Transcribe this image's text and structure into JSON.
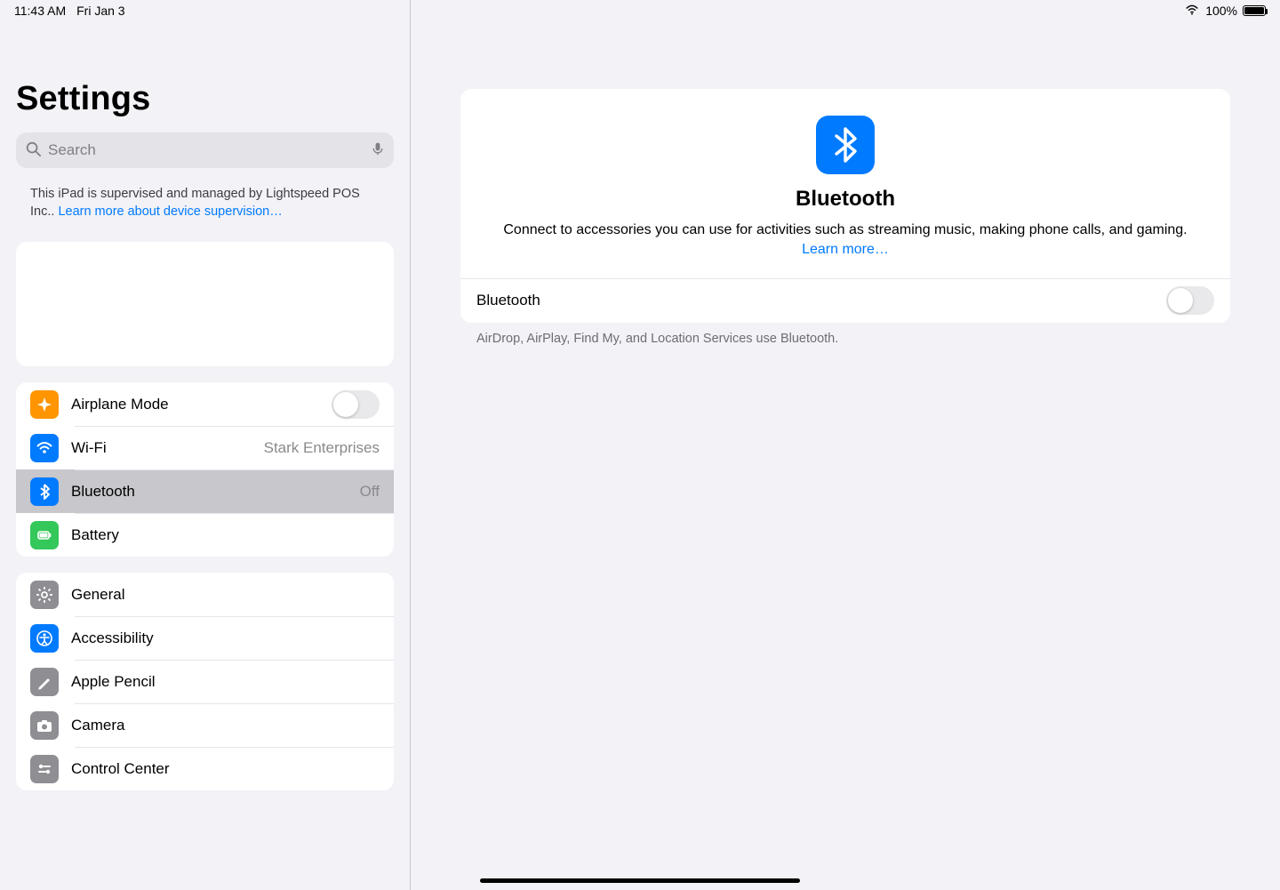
{
  "statusbar": {
    "time": "11:43 AM",
    "date": "Fri Jan 3",
    "battery_pct": "100%"
  },
  "page_title": "Settings",
  "search": {
    "placeholder": "Search"
  },
  "supervision": {
    "text": "This iPad is supervised and managed by Lightspeed POS Inc.. ",
    "link": "Learn more about device supervision…"
  },
  "sidebar": {
    "g1": [
      {
        "label": "Airplane Mode",
        "icon": "airplane",
        "iconbg": "bg-orange",
        "toggle": true
      },
      {
        "label": "Wi-Fi",
        "icon": "wifi",
        "iconbg": "bg-blue",
        "value": "Stark Enterprises"
      },
      {
        "label": "Bluetooth",
        "icon": "bluetooth",
        "iconbg": "bg-blue",
        "value": "Off",
        "selected": true
      },
      {
        "label": "Battery",
        "icon": "battery",
        "iconbg": "bg-green"
      }
    ],
    "g2": [
      {
        "label": "General",
        "icon": "gear",
        "iconbg": "bg-gray"
      },
      {
        "label": "Accessibility",
        "icon": "access",
        "iconbg": "bg-blue"
      },
      {
        "label": "Apple Pencil",
        "icon": "pencil",
        "iconbg": "bg-gray"
      },
      {
        "label": "Camera",
        "icon": "camera",
        "iconbg": "bg-gray"
      },
      {
        "label": "Control Center",
        "icon": "switches",
        "iconbg": "bg-gray"
      }
    ]
  },
  "detail": {
    "title": "Bluetooth",
    "subtitle": "Connect to accessories you can use for activities such as streaming music, making phone calls, and gaming. ",
    "learn_more": "Learn more…",
    "toggle_label": "Bluetooth",
    "footnote": "AirDrop, AirPlay, Find My, and Location Services use Bluetooth."
  }
}
